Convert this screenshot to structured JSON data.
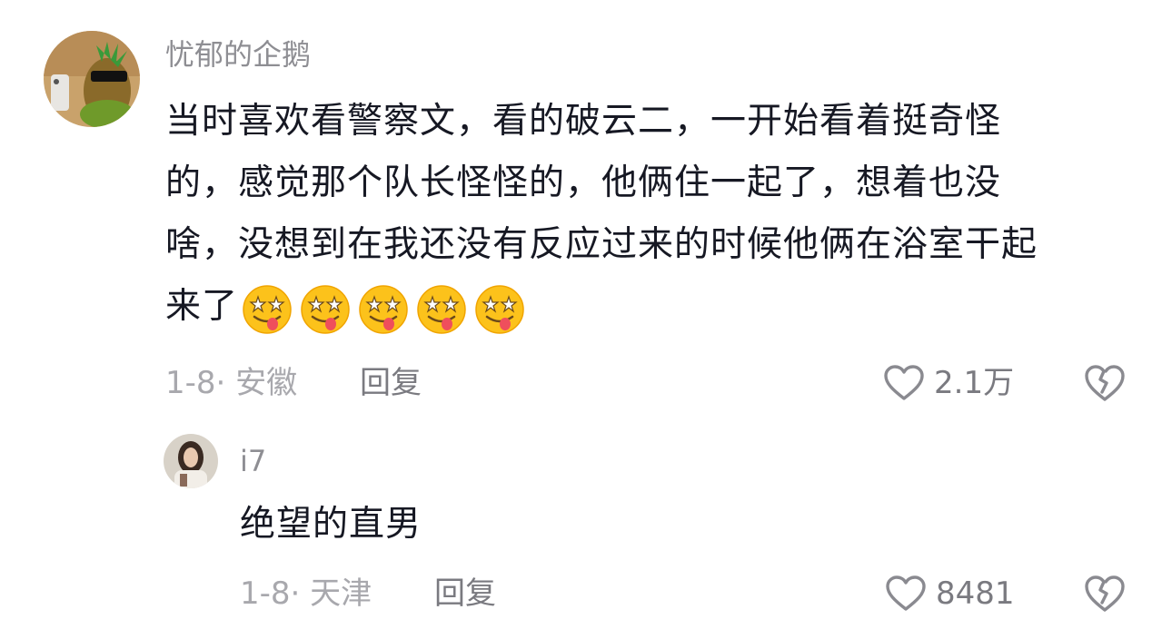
{
  "comment": {
    "username": "忧郁的企鹅",
    "lines": [
      "当时喜欢看警察文，看的破云二，一开始看着挺奇怪",
      "的，感觉那个队长怪怪的，他俩住一起了，想着也没",
      "啥，没想到在我还没有反应过来的时候他俩在浴室干起",
      "来了"
    ],
    "emoji_icon": "drooling-face-emoji",
    "emoji_count": 5,
    "date_location": "1-8· 安徽",
    "reply_label": "回复",
    "like_count": "2.1万",
    "like_icon": "heart-outline-icon",
    "dislike_icon": "broken-heart-icon"
  },
  "reply": {
    "username": "i7",
    "text": "绝望的直男",
    "date_location": "1-8· 天津",
    "reply_label": "回复",
    "like_count": "8481",
    "like_icon": "heart-outline-icon",
    "dislike_icon": "broken-heart-icon"
  },
  "colors": {
    "text_primary": "#161823",
    "text_secondary": "#a8a8ad",
    "username": "#8e8e93",
    "icon": "#8a8a90"
  }
}
